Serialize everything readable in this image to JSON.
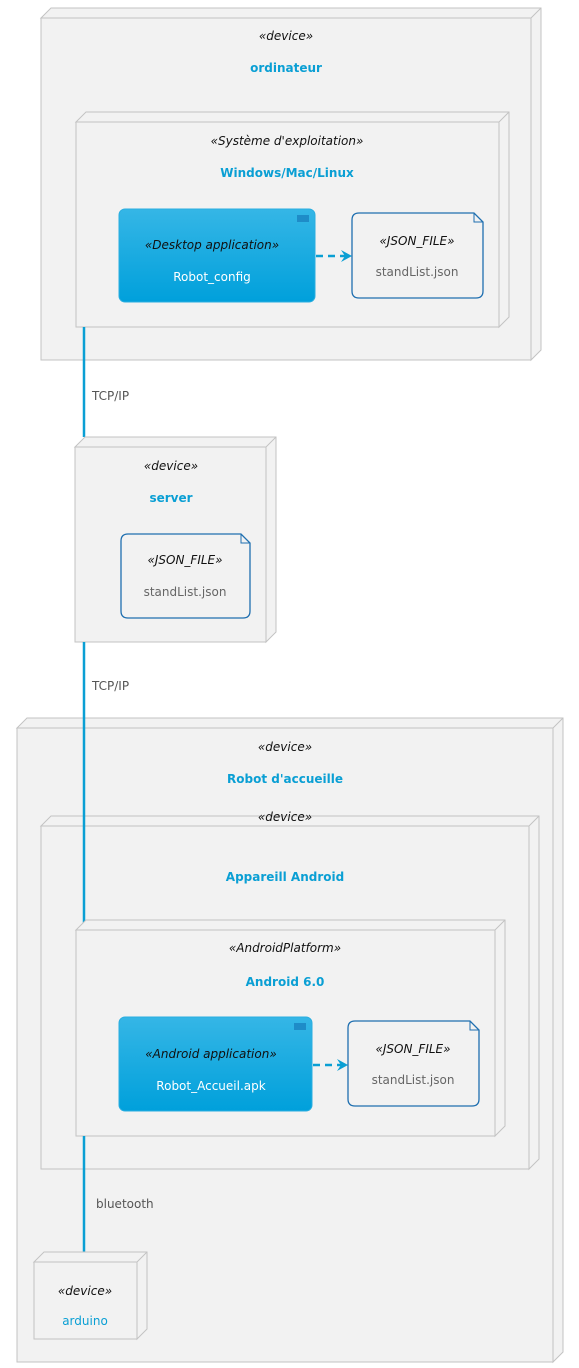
{
  "colors": {
    "accent": "#0a9fd4",
    "node_fill": "#f2f2f2",
    "node_border": "#c3c3c3",
    "file_border": "#1f6fb0",
    "component_fill": "#0aa3dc"
  },
  "nodes": {
    "ordinateur": {
      "stereotype": "«device»",
      "title": "ordinateur"
    },
    "os": {
      "stereotype": "«Système d'exploitation»",
      "title": "Windows/Mac/Linux"
    },
    "server": {
      "stereotype": "«device»",
      "title": "server"
    },
    "robot": {
      "stereotype": "«device»",
      "title": "Robot d'accueille"
    },
    "android_device": {
      "stereotype": "«device»",
      "title": "Appareill Android"
    },
    "android_platform": {
      "stereotype": "«AndroidPlatform»",
      "title": "Android 6.0"
    },
    "arduino": {
      "stereotype": "«device»",
      "title": "arduino"
    }
  },
  "components": {
    "desktop_app": {
      "stereotype": "«Desktop application»",
      "name": "Robot_config",
      "icon": "component-icon"
    },
    "android_app": {
      "stereotype": "«Android application»",
      "name": "Robot_Accueil.apk",
      "icon": "component-icon"
    }
  },
  "files": {
    "pc_file": {
      "stereotype": "«JSON_FILE»",
      "name": "standList.json"
    },
    "server_file": {
      "stereotype": "«JSON_FILE»",
      "name": "standList.json"
    },
    "android_file": {
      "stereotype": "«JSON_FILE»",
      "name": "standList.json"
    }
  },
  "links": {
    "pc_server": "TCP/IP",
    "server_android": "TCP/IP",
    "android_arduino": "bluetooth"
  }
}
